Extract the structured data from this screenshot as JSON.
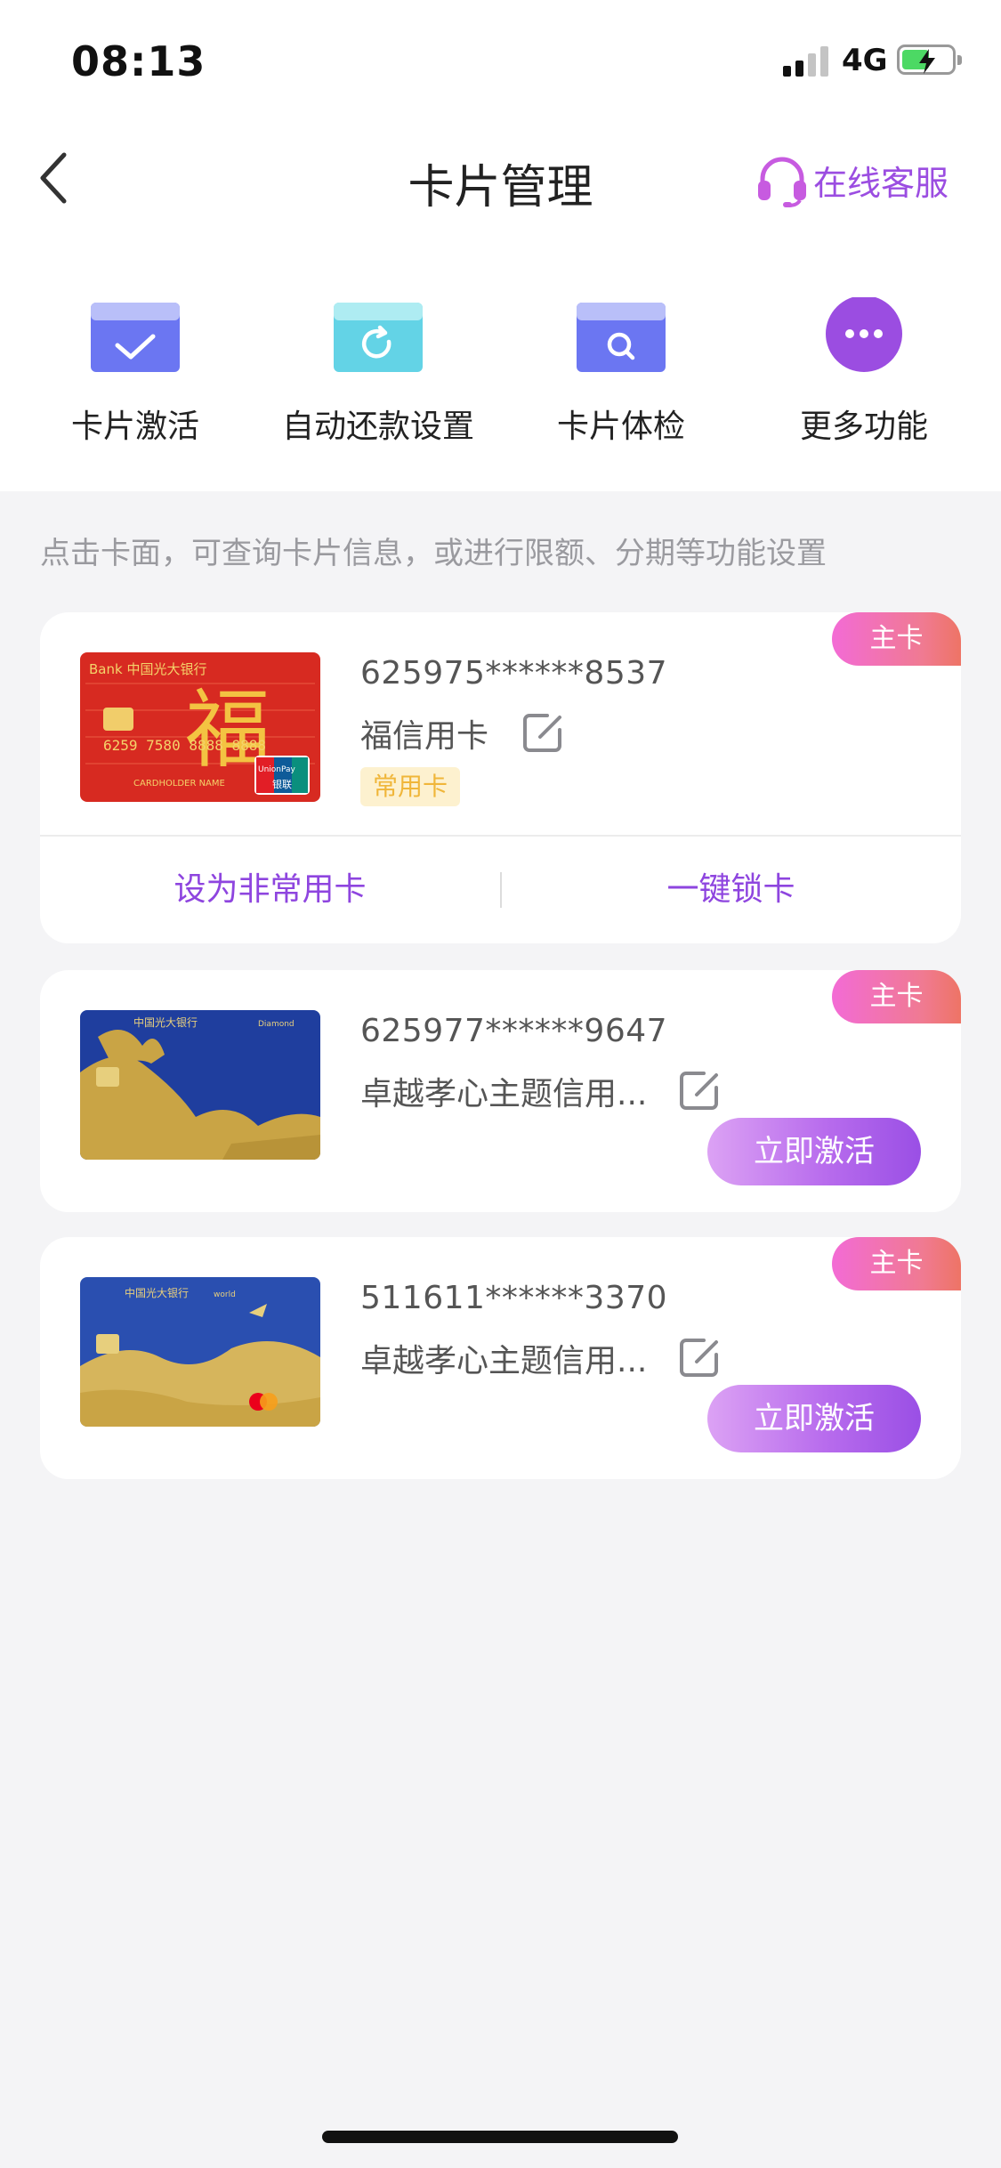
{
  "status_bar": {
    "time": "08:13",
    "network": "4G",
    "battery_level": 0.55
  },
  "header": {
    "title": "卡片管理",
    "service_label": "在线客服",
    "back_icon": "chevron-left-icon",
    "service_icon": "headset-icon"
  },
  "quick_actions": [
    {
      "label": "卡片激活",
      "icon": "card-check-icon"
    },
    {
      "label": "自动还款设置",
      "icon": "card-refresh-icon"
    },
    {
      "label": "卡片体检",
      "icon": "card-search-icon"
    },
    {
      "label": "更多功能",
      "icon": "more-dots-icon"
    }
  ],
  "hint": "点击卡面，可查询卡片信息，或进行限额、分期等功能设置",
  "cards": [
    {
      "badge": "主卡",
      "number": "625975******8537",
      "name": "福信用卡",
      "tag": "常用卡",
      "actions": [
        "设为非常用卡",
        "一键锁卡"
      ],
      "image_text": {
        "bank": "Bank 中国光大银行",
        "char": "福",
        "digits": "6259 7580 8888 8888",
        "holder": "CARDHOLDER NAME",
        "network_a": "UnionPay",
        "network_b": "银联"
      }
    },
    {
      "badge": "主卡",
      "number": "625977******9647",
      "name": "卓越孝心主题信用...",
      "button": "立即激活",
      "image_text": {
        "bank": "中国光大银行",
        "network": "Diamond"
      }
    },
    {
      "badge": "主卡",
      "number": "511611******3370",
      "name": "卓越孝心主题信用...",
      "button": "立即激活",
      "image_text": {
        "bank": "中国光大银行",
        "network": "world"
      }
    }
  ],
  "colors": {
    "accent": "#9b4de1",
    "badge": "#f07a92",
    "tag_bg": "#fdf1cf",
    "tag_text": "#f0b63a"
  }
}
